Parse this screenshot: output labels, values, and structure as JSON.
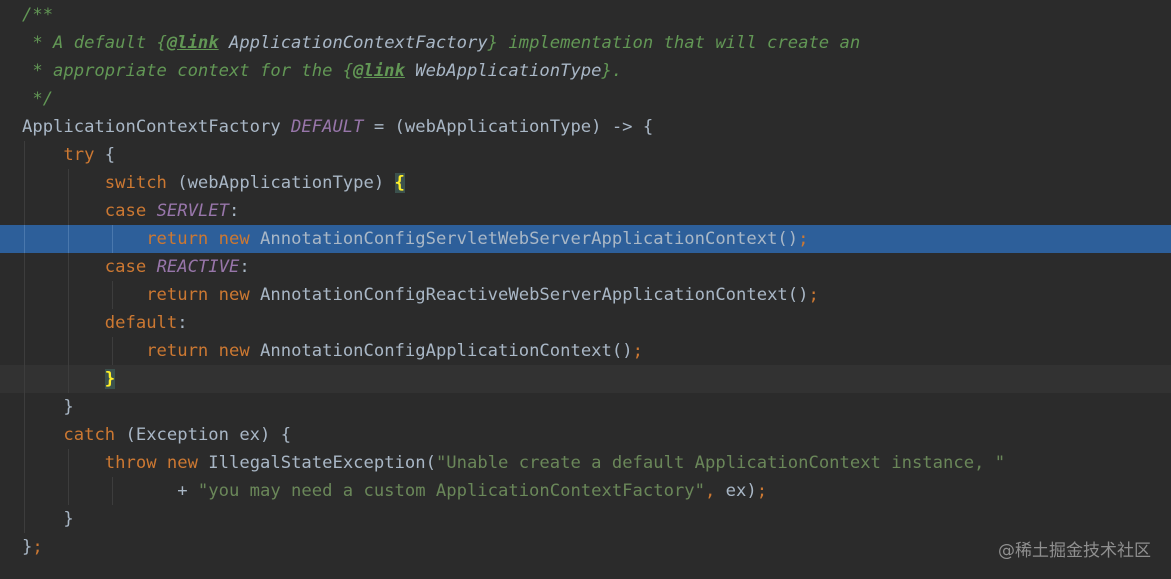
{
  "editor": {
    "colors": {
      "background": "#2b2b2b",
      "selection": "#2d5f9a",
      "keyword": "#cc7832",
      "string": "#6a8759",
      "doc_comment": "#629755",
      "constant": "#9876aa",
      "default_text": "#a9b7c6",
      "brace_match": "#ffef28"
    },
    "selected_line_index": 8,
    "caret_line_index": 13,
    "lines": [
      {
        "tokens": [
          {
            "t": "/**",
            "c": "doc"
          }
        ]
      },
      {
        "tokens": [
          {
            "t": " * A default {",
            "c": "doc"
          },
          {
            "t": "@link",
            "c": "doctag"
          },
          {
            "t": " ApplicationContextFactory",
            "c": "docref"
          },
          {
            "t": "} implementation that will create an",
            "c": "doc"
          }
        ]
      },
      {
        "tokens": [
          {
            "t": " * appropriate context for the {",
            "c": "doc"
          },
          {
            "t": "@link",
            "c": "doctag"
          },
          {
            "t": " WebApplicationType",
            "c": "docref"
          },
          {
            "t": "}.",
            "c": "doc"
          }
        ]
      },
      {
        "tokens": [
          {
            "t": " */",
            "c": "doc"
          }
        ]
      },
      {
        "tokens": [
          {
            "t": "ApplicationContextFactory ",
            "c": "plain"
          },
          {
            "t": "DEFAULT",
            "c": "field"
          },
          {
            "t": " = (webApplicationType) -> {",
            "c": "plain"
          }
        ]
      },
      {
        "tokens": [
          {
            "t": "    ",
            "c": "plain"
          },
          {
            "t": "try",
            "c": "kw"
          },
          {
            "t": " {",
            "c": "plain"
          }
        ]
      },
      {
        "tokens": [
          {
            "t": "        ",
            "c": "plain"
          },
          {
            "t": "switch",
            "c": "kw"
          },
          {
            "t": " (webApplicationType) ",
            "c": "plain"
          },
          {
            "t": "{",
            "c": "brace-match"
          }
        ]
      },
      {
        "tokens": [
          {
            "t": "        ",
            "c": "plain"
          },
          {
            "t": "case",
            "c": "kw"
          },
          {
            "t": " ",
            "c": "plain"
          },
          {
            "t": "SERVLET",
            "c": "field"
          },
          {
            "t": ":",
            "c": "plain"
          }
        ]
      },
      {
        "tokens": [
          {
            "t": "            ",
            "c": "plain"
          },
          {
            "t": "return",
            "c": "kw"
          },
          {
            "t": " ",
            "c": "plain"
          },
          {
            "t": "new",
            "c": "kw"
          },
          {
            "t": " AnnotationConfigServletWebServerApplicationContext()",
            "c": "plain"
          },
          {
            "t": ";",
            "c": "kw"
          }
        ]
      },
      {
        "tokens": [
          {
            "t": "        ",
            "c": "plain"
          },
          {
            "t": "case",
            "c": "kw"
          },
          {
            "t": " ",
            "c": "plain"
          },
          {
            "t": "REACTIVE",
            "c": "field"
          },
          {
            "t": ":",
            "c": "plain"
          }
        ]
      },
      {
        "tokens": [
          {
            "t": "            ",
            "c": "plain"
          },
          {
            "t": "return",
            "c": "kw"
          },
          {
            "t": " ",
            "c": "plain"
          },
          {
            "t": "new",
            "c": "kw"
          },
          {
            "t": " AnnotationConfigReactiveWebServerApplicationContext()",
            "c": "plain"
          },
          {
            "t": ";",
            "c": "kw"
          }
        ]
      },
      {
        "tokens": [
          {
            "t": "        ",
            "c": "plain"
          },
          {
            "t": "default",
            "c": "kw"
          },
          {
            "t": ":",
            "c": "plain"
          }
        ]
      },
      {
        "tokens": [
          {
            "t": "            ",
            "c": "plain"
          },
          {
            "t": "return",
            "c": "kw"
          },
          {
            "t": " ",
            "c": "plain"
          },
          {
            "t": "new",
            "c": "kw"
          },
          {
            "t": " AnnotationConfigApplicationContext()",
            "c": "plain"
          },
          {
            "t": ";",
            "c": "kw"
          }
        ]
      },
      {
        "tokens": [
          {
            "t": "        ",
            "c": "plain"
          },
          {
            "t": "}",
            "c": "brace-match"
          }
        ]
      },
      {
        "tokens": [
          {
            "t": "    }",
            "c": "plain"
          }
        ]
      },
      {
        "tokens": [
          {
            "t": "    ",
            "c": "plain"
          },
          {
            "t": "catch",
            "c": "kw"
          },
          {
            "t": " (Exception ex) {",
            "c": "plain"
          }
        ]
      },
      {
        "tokens": [
          {
            "t": "        ",
            "c": "plain"
          },
          {
            "t": "throw",
            "c": "kw"
          },
          {
            "t": " ",
            "c": "plain"
          },
          {
            "t": "new",
            "c": "kw"
          },
          {
            "t": " IllegalStateException(",
            "c": "plain"
          },
          {
            "t": "\"Unable create a default ApplicationContext instance, \"",
            "c": "str"
          }
        ]
      },
      {
        "tokens": [
          {
            "t": "               + ",
            "c": "plain"
          },
          {
            "t": "\"you may need a custom ApplicationContextFactory\"",
            "c": "str"
          },
          {
            "t": ",",
            "c": "kw"
          },
          {
            "t": " ex)",
            "c": "plain"
          },
          {
            "t": ";",
            "c": "kw"
          }
        ]
      },
      {
        "tokens": [
          {
            "t": "    }",
            "c": "plain"
          }
        ]
      },
      {
        "tokens": [
          {
            "t": "}",
            "c": "plain"
          },
          {
            "t": ";",
            "c": "kw"
          }
        ]
      }
    ]
  },
  "watermark": "@稀土掘金技术社区"
}
